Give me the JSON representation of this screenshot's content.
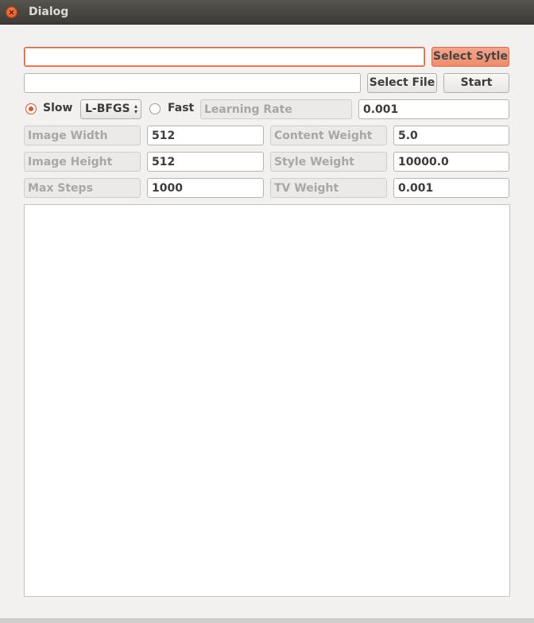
{
  "window": {
    "title": "Dialog"
  },
  "style_path": {
    "value": ""
  },
  "select_style_button": "Select Sytle",
  "file_path": {
    "value": ""
  },
  "select_file_button": "Select File",
  "start_button": "Start",
  "mode": {
    "slow_label": "Slow",
    "slow_checked": true,
    "optimizer": "L-BFGS",
    "fast_label": "Fast",
    "fast_checked": false
  },
  "params": {
    "learning_rate": {
      "label": "Learning Rate",
      "value": "0.001"
    },
    "image_width": {
      "label": "Image Width",
      "value": "512"
    },
    "content_weight": {
      "label": "Content Weight",
      "value": "5.0"
    },
    "image_height": {
      "label": "Image Height",
      "value": "512"
    },
    "style_weight": {
      "label": "Style Weight",
      "value": "10000.0"
    },
    "max_steps": {
      "label": "Max Steps",
      "value": "1000"
    },
    "tv_weight": {
      "label": "TV Weight",
      "value": "0.001"
    }
  }
}
